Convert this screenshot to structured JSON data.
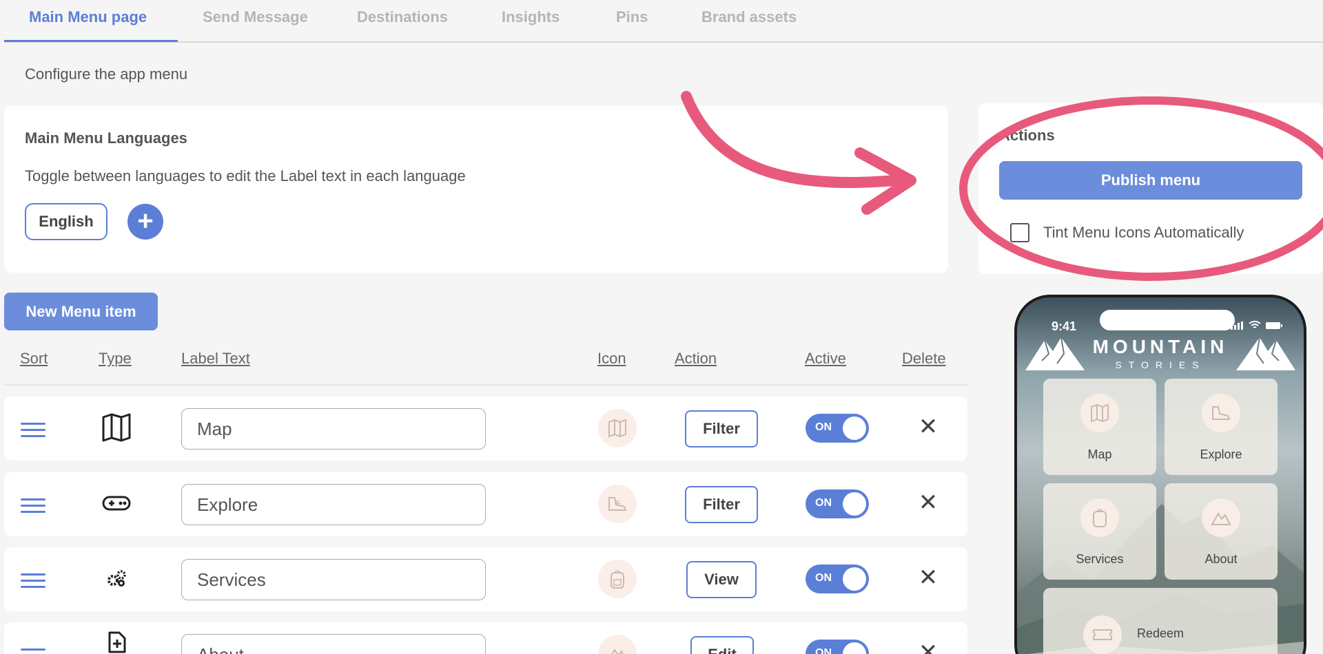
{
  "tabs": [
    {
      "label": "Main Menu page",
      "active": true
    },
    {
      "label": "Send Message"
    },
    {
      "label": "Destinations"
    },
    {
      "label": "Insights"
    },
    {
      "label": "Pins"
    },
    {
      "label": "Brand assets"
    }
  ],
  "subtitle": "Configure the app menu",
  "languages": {
    "title": "Main Menu Languages",
    "description": "Toggle between languages to edit the Label text in each language",
    "current": "English",
    "add_icon": "plus-icon"
  },
  "actions": {
    "title": "Actions",
    "publish_label": "Publish menu",
    "tint_label": "Tint Menu Icons Automatically",
    "tint_checked": false
  },
  "new_item_label": "New Menu item",
  "columns": [
    "Sort",
    "Type",
    "Label Text",
    "Icon",
    "Action",
    "Active",
    "Delete"
  ],
  "rows": [
    {
      "type_icon": "map-icon",
      "label": "Map",
      "icon": "map-thumbnail",
      "action": "Filter",
      "active": "ON"
    },
    {
      "type_icon": "gamepad-icon",
      "label": "Explore",
      "icon": "hiking-boots-thumbnail",
      "action": "Filter",
      "active": "ON"
    },
    {
      "type_icon": "gears-icon",
      "label": "Services",
      "icon": "backpack-thumbnail",
      "action": "View",
      "active": "ON"
    },
    {
      "type_icon": "add-document-icon",
      "label": "About",
      "icon": "mountain-thumbnail",
      "action": "Edit",
      "active": "ON"
    }
  ],
  "preview": {
    "time": "9:41",
    "brand_title": "MOUNTAIN",
    "brand_subtitle": "STORIES",
    "tiles": [
      "Map",
      "Explore",
      "Services",
      "About",
      "Redeem"
    ]
  },
  "colors": {
    "accent": "#5b7fd6",
    "button": "#6b8ddb",
    "annotation": "#e75a7c"
  }
}
